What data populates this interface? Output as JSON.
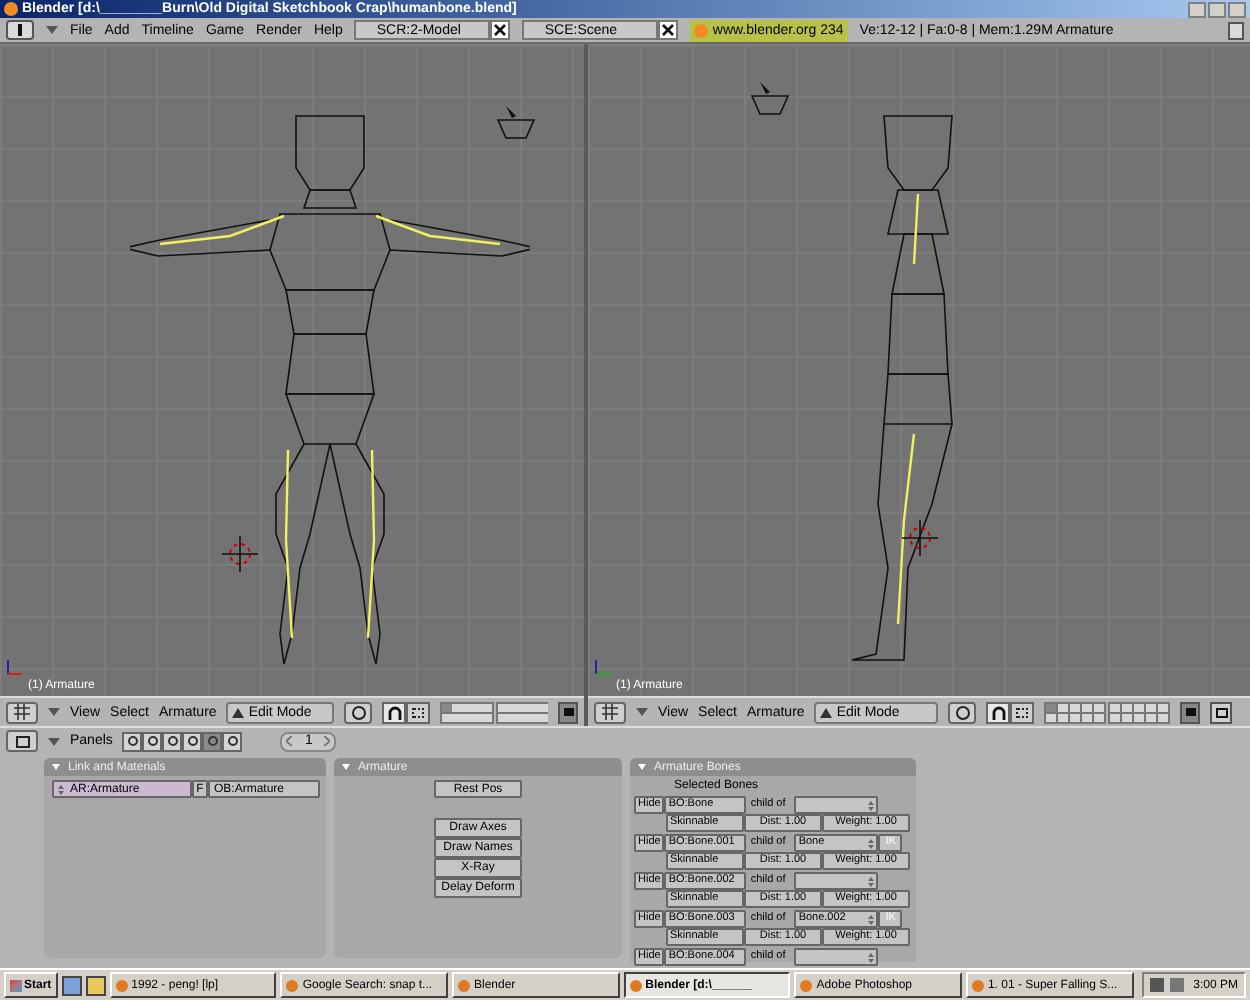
{
  "window": {
    "title": "Blender [d:\\________Burn\\Old Digital Sketchbook Crap\\humanbone.blend]"
  },
  "menu_bar": {
    "menus": [
      "File",
      "Add",
      "Timeline",
      "Game",
      "Render",
      "Help"
    ],
    "screen": "SCR:2-Model",
    "scene": "SCE:Scene",
    "url": "www.blender.org 234",
    "stats": "Ve:12-12 | Fa:0-8 | Mem:1.29M Armature"
  },
  "viewports": [
    {
      "kind": "front",
      "label": "(1) Armature",
      "menus": [
        "View",
        "Select",
        "Armature"
      ],
      "mode": "Edit Mode"
    },
    {
      "kind": "side",
      "label": "(1) Armature",
      "menus": [
        "View",
        "Select",
        "Armature"
      ],
      "mode": "Edit Mode"
    }
  ],
  "buttons_header": {
    "label": "Panels",
    "frame": "1",
    "contexts": [
      {
        "selected": false
      },
      {
        "selected": false
      },
      {
        "selected": false
      },
      {
        "selected": false
      },
      {
        "selected": true
      },
      {
        "selected": false
      }
    ]
  },
  "link_panel": {
    "title": "Link and Materials",
    "armature": "AR:Armature",
    "fake": "F",
    "object": "OB:Armature"
  },
  "armature_panel": {
    "title": "Armature",
    "rest": "Rest Pos",
    "toggles": [
      "Draw Axes",
      "Draw Names",
      "X-Ray",
      "Delay Deform"
    ]
  },
  "bones_panel": {
    "title": "Armature Bones",
    "subtitle": "Selected Bones",
    "bones": [
      {
        "hide": "Hide",
        "name": "BO:Bone",
        "child_of": "child of",
        "ik": false,
        "skin": "Skinnable",
        "dist": "Dist: 1.00",
        "weight": "Weight: 1.00"
      },
      {
        "hide": "Hide",
        "name": "BO:Bone.001",
        "child_of": "child of",
        "parent": "Bone",
        "ik": true,
        "ik_label": "IK",
        "skin": "Skinnable",
        "dist": "Dist: 1.00",
        "weight": "Weight: 1.00"
      },
      {
        "hide": "Hide",
        "name": "BO:Bone.002",
        "child_of": "child of",
        "ik": false,
        "skin": "Skinnable",
        "dist": "Dist: 1.00",
        "weight": "Weight: 1.00"
      },
      {
        "hide": "Hide",
        "name": "BO:Bone.003",
        "child_of": "child of",
        "parent": "Bone.002",
        "ik": true,
        "ik_label": "IK",
        "skin": "Skinnable",
        "dist": "Dist: 1.00",
        "weight": "Weight: 1.00"
      },
      {
        "hide": "Hide",
        "name": "BO:Bone.004",
        "child_of": "child of",
        "ik": false
      }
    ]
  },
  "taskbar": {
    "start": "Start",
    "tasks": [
      {
        "label": "1992 - peng! [lp]",
        "selected": false
      },
      {
        "label": "Google Search: snap t...",
        "selected": false
      },
      {
        "label": "Blender",
        "selected": false
      },
      {
        "label": "Blender [d:\\______",
        "selected": true
      },
      {
        "label": "Adobe Photoshop",
        "selected": false
      },
      {
        "label": "1. 01 - Super Falling S...",
        "selected": false
      }
    ],
    "clock": "3:00 PM"
  }
}
